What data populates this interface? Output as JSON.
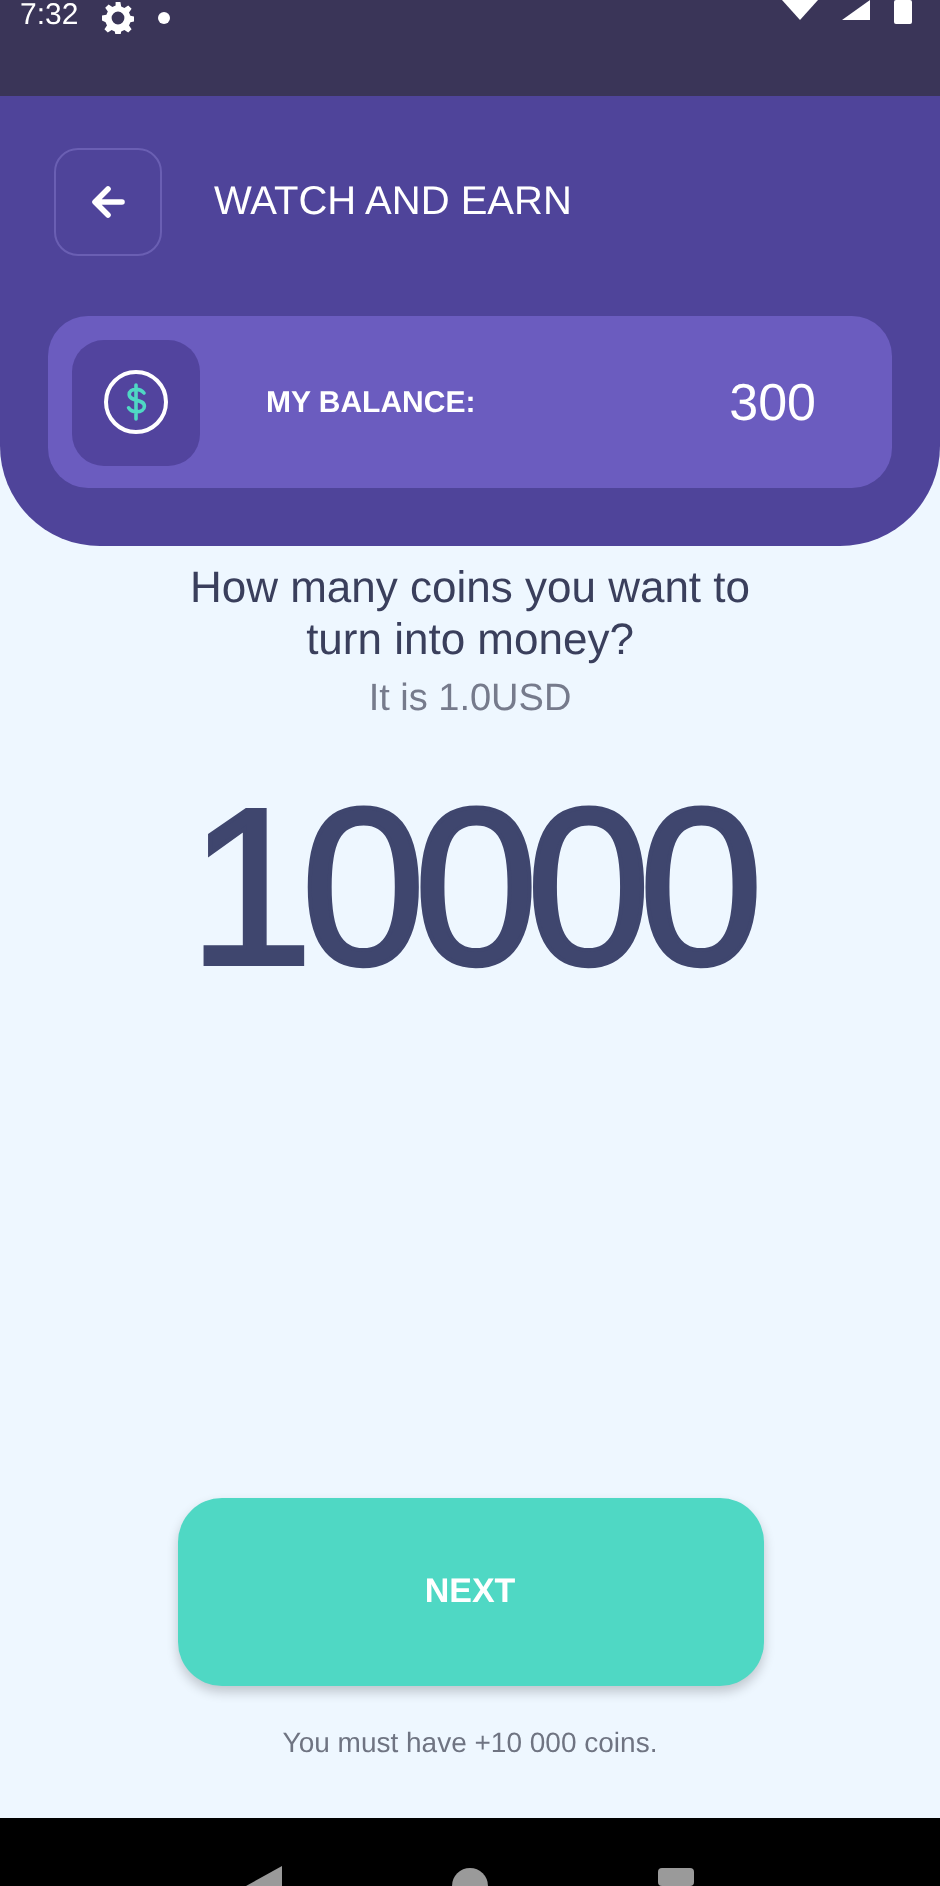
{
  "status_bar": {
    "time": "7:32"
  },
  "header": {
    "title": "WATCH AND EARN"
  },
  "balance": {
    "label": "MY BALANCE:",
    "value": "300"
  },
  "question": "How many coins you want to turn into money?",
  "conversion": "It is 1.0USD",
  "amount": "10000",
  "button": {
    "label": "NEXT"
  },
  "hint": "You must have +10 000 coins."
}
